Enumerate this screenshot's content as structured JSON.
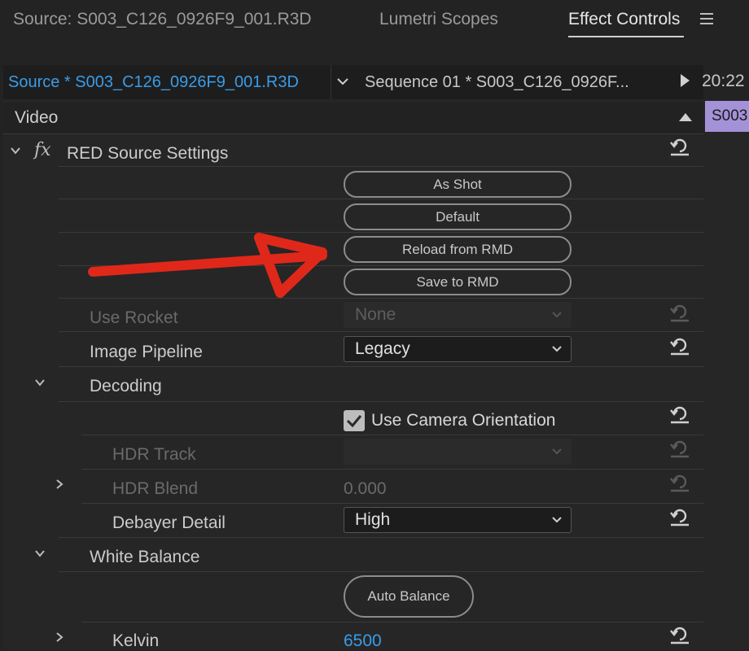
{
  "top_tabs": {
    "source": "Source: S003_C126_0926F9_001.R3D",
    "lumetri": "Lumetri Scopes",
    "effect_controls": "Effect Controls"
  },
  "clip_bar": {
    "source_clip": "Source * S003_C126_0926F9_001.R3D",
    "sequence_clip": "Sequence 01 * S003_C126_0926F...",
    "timecode": "20:22",
    "timeline_clip": "S003"
  },
  "section": {
    "video": "Video"
  },
  "effect": {
    "fx": "fx",
    "name": "RED Source Settings"
  },
  "buttons": {
    "as_shot": "As Shot",
    "default": "Default",
    "reload_rmd": "Reload from RMD",
    "save_rmd": "Save to RMD",
    "auto_balance": "Auto Balance"
  },
  "params": {
    "use_rocket": {
      "label": "Use Rocket",
      "value": "None"
    },
    "image_pipeline": {
      "label": "Image Pipeline",
      "value": "Legacy"
    },
    "decoding": {
      "label": "Decoding"
    },
    "use_camera_orientation": {
      "label": "Use Camera Orientation",
      "checked": true
    },
    "hdr_track": {
      "label": "HDR Track",
      "value": ""
    },
    "hdr_blend": {
      "label": "HDR Blend",
      "value": "0.000"
    },
    "debayer_detail": {
      "label": "Debayer Detail",
      "value": "High"
    },
    "white_balance": {
      "label": "White Balance"
    },
    "kelvin": {
      "label": "Kelvin",
      "value": "6500"
    }
  },
  "colors": {
    "accent_blue": "#3a9ce8",
    "annotation_red": "#e0281a",
    "clip_purple": "#a492d8"
  }
}
